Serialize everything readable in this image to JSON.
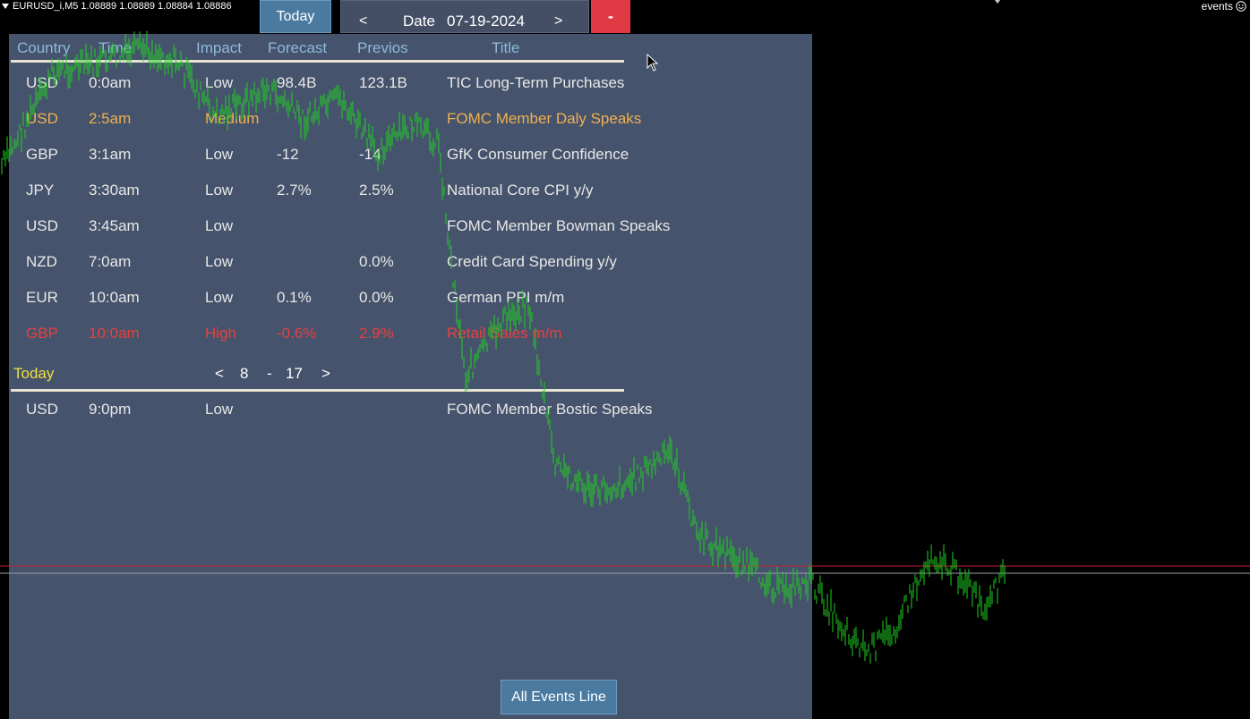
{
  "topbar": {
    "symbol_text": "EURUSD_i,M5  1.08889 1.08889 1.08884 1.08886",
    "events_label": "events"
  },
  "toolbar": {
    "today_label": "Today",
    "date_prev": "<",
    "date_label": "Date",
    "date_value": "07-19-2024",
    "date_next": ">",
    "close_label": "-"
  },
  "table": {
    "headers": [
      "Country",
      "Time",
      "Impact",
      "Forecast",
      "Previos",
      "Title"
    ],
    "rows": [
      {
        "country": "USD",
        "time": "0:0am",
        "impact": "Low",
        "forecast": "98.4B",
        "previous": "123.1B",
        "title": "TIC Long-Term Purchases",
        "level": "low"
      },
      {
        "country": "USD",
        "time": "2:5am",
        "impact": "Medium",
        "forecast": "",
        "previous": "",
        "title": "FOMC Member Daly Speaks",
        "level": "medium"
      },
      {
        "country": "GBP",
        "time": "3:1am",
        "impact": "Low",
        "forecast": "-12",
        "previous": "-14",
        "title": "GfK Consumer Confidence",
        "level": "low"
      },
      {
        "country": "JPY",
        "time": "3:30am",
        "impact": "Low",
        "forecast": "2.7%",
        "previous": "2.5%",
        "title": "National Core CPI y/y",
        "level": "low"
      },
      {
        "country": "USD",
        "time": "3:45am",
        "impact": "Low",
        "forecast": "",
        "previous": "",
        "title": "FOMC Member Bowman Speaks",
        "level": "low"
      },
      {
        "country": "NZD",
        "time": "7:0am",
        "impact": "Low",
        "forecast": "",
        "previous": "0.0%",
        "title": "Credit Card Spending y/y",
        "level": "low"
      },
      {
        "country": "EUR",
        "time": "10:0am",
        "impact": "Low",
        "forecast": "0.1%",
        "previous": "0.0%",
        "title": "German PPI m/m",
        "level": "low"
      },
      {
        "country": "GBP",
        "time": "10:0am",
        "impact": "High",
        "forecast": "-0.6%",
        "previous": "2.9%",
        "title": "Retail Sales m/m",
        "level": "high"
      }
    ]
  },
  "pager": {
    "today_label": "Today",
    "prev": "<",
    "current": "8",
    "sep": "-",
    "total": "17",
    "next": ">"
  },
  "upcoming": [
    {
      "country": "USD",
      "time": "9:0pm",
      "impact": "Low",
      "forecast": "",
      "previous": "",
      "title": "FOMC Member Bostic Speaks",
      "level": "low"
    }
  ],
  "footer": {
    "all_events_label": "All Events Line"
  },
  "colors": {
    "low": "#e8e8e8",
    "medium": "#f0b050",
    "high": "#e84040",
    "today": "#f0e040",
    "header": "#8fb8dc",
    "candle": "#20d020"
  }
}
